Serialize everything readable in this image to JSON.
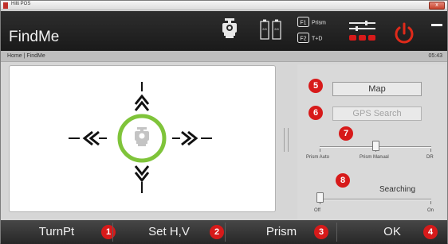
{
  "window": {
    "title": "Hilti POS",
    "close_glyph": "x"
  },
  "header": {
    "title": "FindMe",
    "prism_icon": "prism-icon",
    "battery_icon": "battery-icon",
    "battery_labels": [
      "2/4",
      "2/4"
    ],
    "f1_key": "F1",
    "f1_label": "Prism",
    "f2_key": "F2",
    "f2_label": "T+D",
    "settings_icon": "settings-sliders-icon",
    "power_icon": "power-icon",
    "minimize_icon": "minimize-icon",
    "colors": {
      "accent_red": "#d71a1a",
      "header_bg": "#1f1f1f"
    }
  },
  "breadcrumb": {
    "text": "Home | FindMe",
    "time": "05:43"
  },
  "viewport": {
    "up_arrow": "arrow-up-icon",
    "down_arrow": "arrow-down-icon",
    "left_arrow": "arrow-left-icon",
    "right_arrow": "arrow-right-icon",
    "target_ring_color": "#7fc43a",
    "target_icon": "prism-target-icon"
  },
  "panel": {
    "map_badge": "5",
    "map_button": "Map",
    "gps_badge": "6",
    "gps_button": "GPS Search",
    "mode_badge": "7",
    "mode_slider": {
      "labels": [
        "Prism Auto",
        "Prism Manual",
        "DR"
      ],
      "value": "Prism Manual",
      "level": 0.5
    },
    "search_badge": "8",
    "search_slider": {
      "title": "Searching",
      "labels": [
        "Off",
        "On"
      ],
      "value": "Off",
      "level": 0.0
    }
  },
  "softkeys": [
    {
      "label": "TurnPt",
      "badge": "1"
    },
    {
      "label": "Set H,V",
      "badge": "2"
    },
    {
      "label": "Prism",
      "badge": "3"
    },
    {
      "label": "OK",
      "badge": "4"
    }
  ]
}
